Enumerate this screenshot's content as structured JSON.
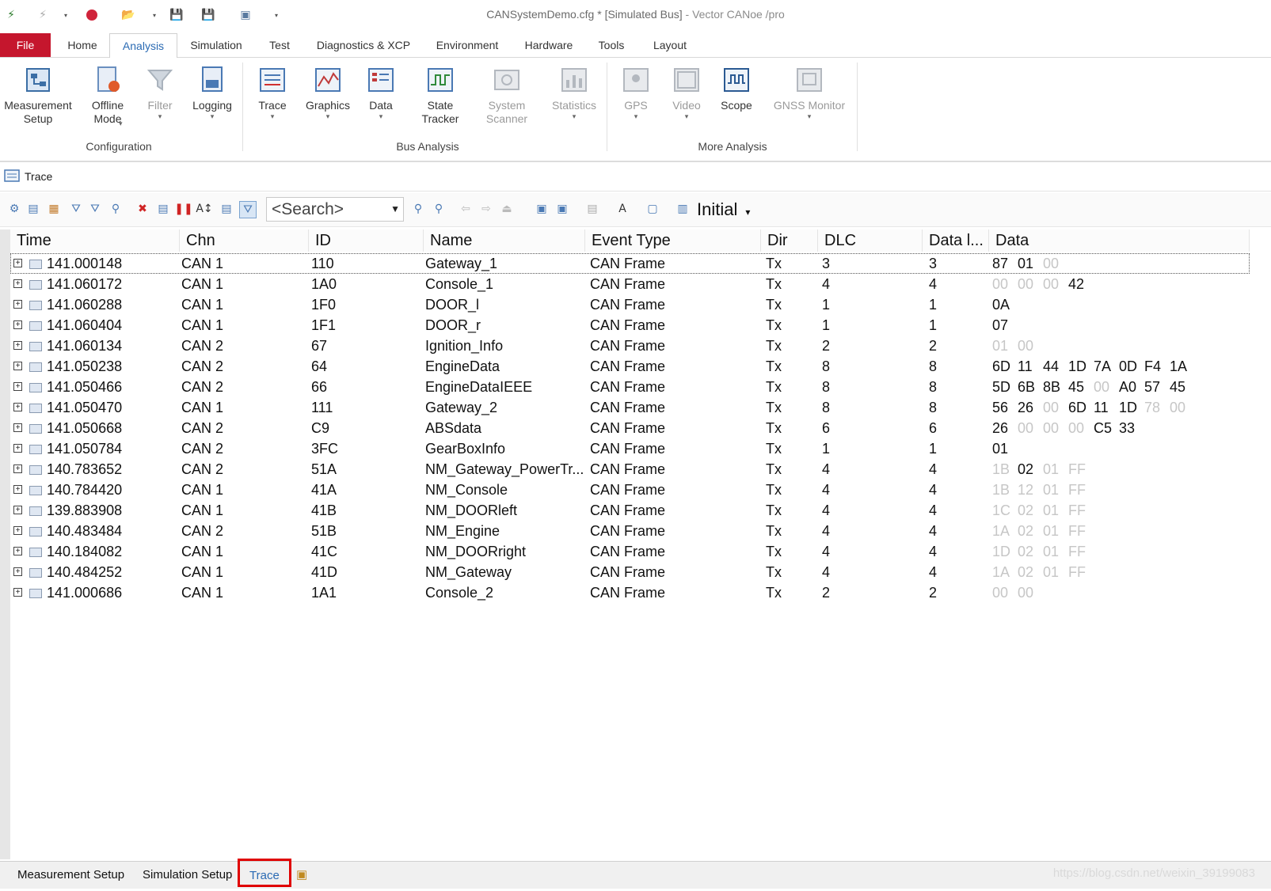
{
  "window": {
    "title_doc": "CANSystemDemo.cfg * [Simulated Bus]",
    "title_app": " - Vector CANoe /pro"
  },
  "ribbon_tabs": [
    "File",
    "Home",
    "Analysis",
    "Simulation",
    "Test",
    "Diagnostics & XCP",
    "Environment",
    "Hardware",
    "Tools",
    "Layout"
  ],
  "ribbon": {
    "measurement_setup": "Measurement\nSetup",
    "offline_mode": "Offline\nMode",
    "filter": "Filter",
    "logging": "Logging",
    "trace": "Trace",
    "graphics": "Graphics",
    "data": "Data",
    "state_tracker": "State\nTracker",
    "system_scanner": "System\nScanner",
    "statistics": "Statistics",
    "gps": "GPS",
    "video": "Video",
    "scope": "Scope",
    "gnss_monitor": "GNSS Monitor",
    "group_configuration": "Configuration",
    "group_bus_analysis": "Bus Analysis",
    "group_more_analysis": "More Analysis"
  },
  "trace_window": {
    "title": "Trace",
    "search_placeholder": "<Search>",
    "layout_label": "Initial"
  },
  "columns": [
    "Time",
    "Chn",
    "ID",
    "Name",
    "Event Type",
    "Dir",
    "DLC",
    "Data l...",
    "Data"
  ],
  "rows": [
    {
      "time": "141.000148",
      "chn": "CAN 1",
      "id": "110",
      "name": "Gateway_1",
      "event": "CAN Frame",
      "dir": "Tx",
      "dlc": "3",
      "dlen": "3",
      "data": [
        "87",
        "01",
        "00"
      ],
      "dim": [
        2
      ]
    },
    {
      "time": "141.060172",
      "chn": "CAN 1",
      "id": "1A0",
      "name": "Console_1",
      "event": "CAN Frame",
      "dir": "Tx",
      "dlc": "4",
      "dlen": "4",
      "data": [
        "00",
        "00",
        "00",
        "42"
      ],
      "dim": [
        0,
        1,
        2
      ]
    },
    {
      "time": "141.060288",
      "chn": "CAN 1",
      "id": "1F0",
      "name": "DOOR_l",
      "event": "CAN Frame",
      "dir": "Tx",
      "dlc": "1",
      "dlen": "1",
      "data": [
        "0A"
      ],
      "dim": []
    },
    {
      "time": "141.060404",
      "chn": "CAN 1",
      "id": "1F1",
      "name": "DOOR_r",
      "event": "CAN Frame",
      "dir": "Tx",
      "dlc": "1",
      "dlen": "1",
      "data": [
        "07"
      ],
      "dim": []
    },
    {
      "time": "141.060134",
      "chn": "CAN 2",
      "id": "67",
      "name": "Ignition_Info",
      "event": "CAN Frame",
      "dir": "Tx",
      "dlc": "2",
      "dlen": "2",
      "data": [
        "01",
        "00"
      ],
      "dim": [
        0,
        1
      ]
    },
    {
      "time": "141.050238",
      "chn": "CAN 2",
      "id": "64",
      "name": "EngineData",
      "event": "CAN Frame",
      "dir": "Tx",
      "dlc": "8",
      "dlen": "8",
      "data": [
        "6D",
        "11",
        "44",
        "1D",
        "7A",
        "0D",
        "F4",
        "1A"
      ],
      "dim": []
    },
    {
      "time": "141.050466",
      "chn": "CAN 2",
      "id": "66",
      "name": "EngineDataIEEE",
      "event": "CAN Frame",
      "dir": "Tx",
      "dlc": "8",
      "dlen": "8",
      "data": [
        "5D",
        "6B",
        "8B",
        "45",
        "00",
        "A0",
        "57",
        "45"
      ],
      "dim": [
        4
      ]
    },
    {
      "time": "141.050470",
      "chn": "CAN 1",
      "id": "111",
      "name": "Gateway_2",
      "event": "CAN Frame",
      "dir": "Tx",
      "dlc": "8",
      "dlen": "8",
      "data": [
        "56",
        "26",
        "00",
        "6D",
        "11",
        "1D",
        "78",
        "00"
      ],
      "dim": [
        2,
        6,
        7
      ]
    },
    {
      "time": "141.050668",
      "chn": "CAN 2",
      "id": "C9",
      "name": "ABSdata",
      "event": "CAN Frame",
      "dir": "Tx",
      "dlc": "6",
      "dlen": "6",
      "data": [
        "26",
        "00",
        "00",
        "00",
        "C5",
        "33"
      ],
      "dim": [
        1,
        2,
        3
      ]
    },
    {
      "time": "141.050784",
      "chn": "CAN 2",
      "id": "3FC",
      "name": "GearBoxInfo",
      "event": "CAN Frame",
      "dir": "Tx",
      "dlc": "1",
      "dlen": "1",
      "data": [
        "01"
      ],
      "dim": []
    },
    {
      "time": "140.783652",
      "chn": "CAN 2",
      "id": "51A",
      "name": "NM_Gateway_PowerTr...",
      "event": "CAN Frame",
      "dir": "Tx",
      "dlc": "4",
      "dlen": "4",
      "data": [
        "1B",
        "02",
        "01",
        "FF"
      ],
      "dim": [
        0,
        2,
        3
      ]
    },
    {
      "time": "140.784420",
      "chn": "CAN 1",
      "id": "41A",
      "name": "NM_Console",
      "event": "CAN Frame",
      "dir": "Tx",
      "dlc": "4",
      "dlen": "4",
      "data": [
        "1B",
        "12",
        "01",
        "FF"
      ],
      "dim": [
        0,
        1,
        2,
        3
      ]
    },
    {
      "time": "139.883908",
      "chn": "CAN 1",
      "id": "41B",
      "name": "NM_DOORleft",
      "event": "CAN Frame",
      "dir": "Tx",
      "dlc": "4",
      "dlen": "4",
      "data": [
        "1C",
        "02",
        "01",
        "FF"
      ],
      "dim": [
        0,
        1,
        2,
        3
      ]
    },
    {
      "time": "140.483484",
      "chn": "CAN 2",
      "id": "51B",
      "name": "NM_Engine",
      "event": "CAN Frame",
      "dir": "Tx",
      "dlc": "4",
      "dlen": "4",
      "data": [
        "1A",
        "02",
        "01",
        "FF"
      ],
      "dim": [
        0,
        1,
        2,
        3
      ]
    },
    {
      "time": "140.184082",
      "chn": "CAN 1",
      "id": "41C",
      "name": "NM_DOORright",
      "event": "CAN Frame",
      "dir": "Tx",
      "dlc": "4",
      "dlen": "4",
      "data": [
        "1D",
        "02",
        "01",
        "FF"
      ],
      "dim": [
        0,
        1,
        2,
        3
      ]
    },
    {
      "time": "140.484252",
      "chn": "CAN 1",
      "id": "41D",
      "name": "NM_Gateway",
      "event": "CAN Frame",
      "dir": "Tx",
      "dlc": "4",
      "dlen": "4",
      "data": [
        "1A",
        "02",
        "01",
        "FF"
      ],
      "dim": [
        0,
        1,
        2,
        3
      ]
    },
    {
      "time": "141.000686",
      "chn": "CAN 1",
      "id": "1A1",
      "name": "Console_2",
      "event": "CAN Frame",
      "dir": "Tx",
      "dlc": "2",
      "dlen": "2",
      "data": [
        "00",
        "00"
      ],
      "dim": [
        0,
        1
      ]
    }
  ],
  "bottom_tabs": [
    "Measurement Setup",
    "Simulation Setup",
    "Trace"
  ],
  "watermark": "https://blog.csdn.net/weixin_39199083",
  "colors": {
    "file_tab": "#c5162d",
    "accent": "#2a6ab3",
    "highlight_box": "#e00000",
    "dim_byte": "#c6c6c6"
  }
}
